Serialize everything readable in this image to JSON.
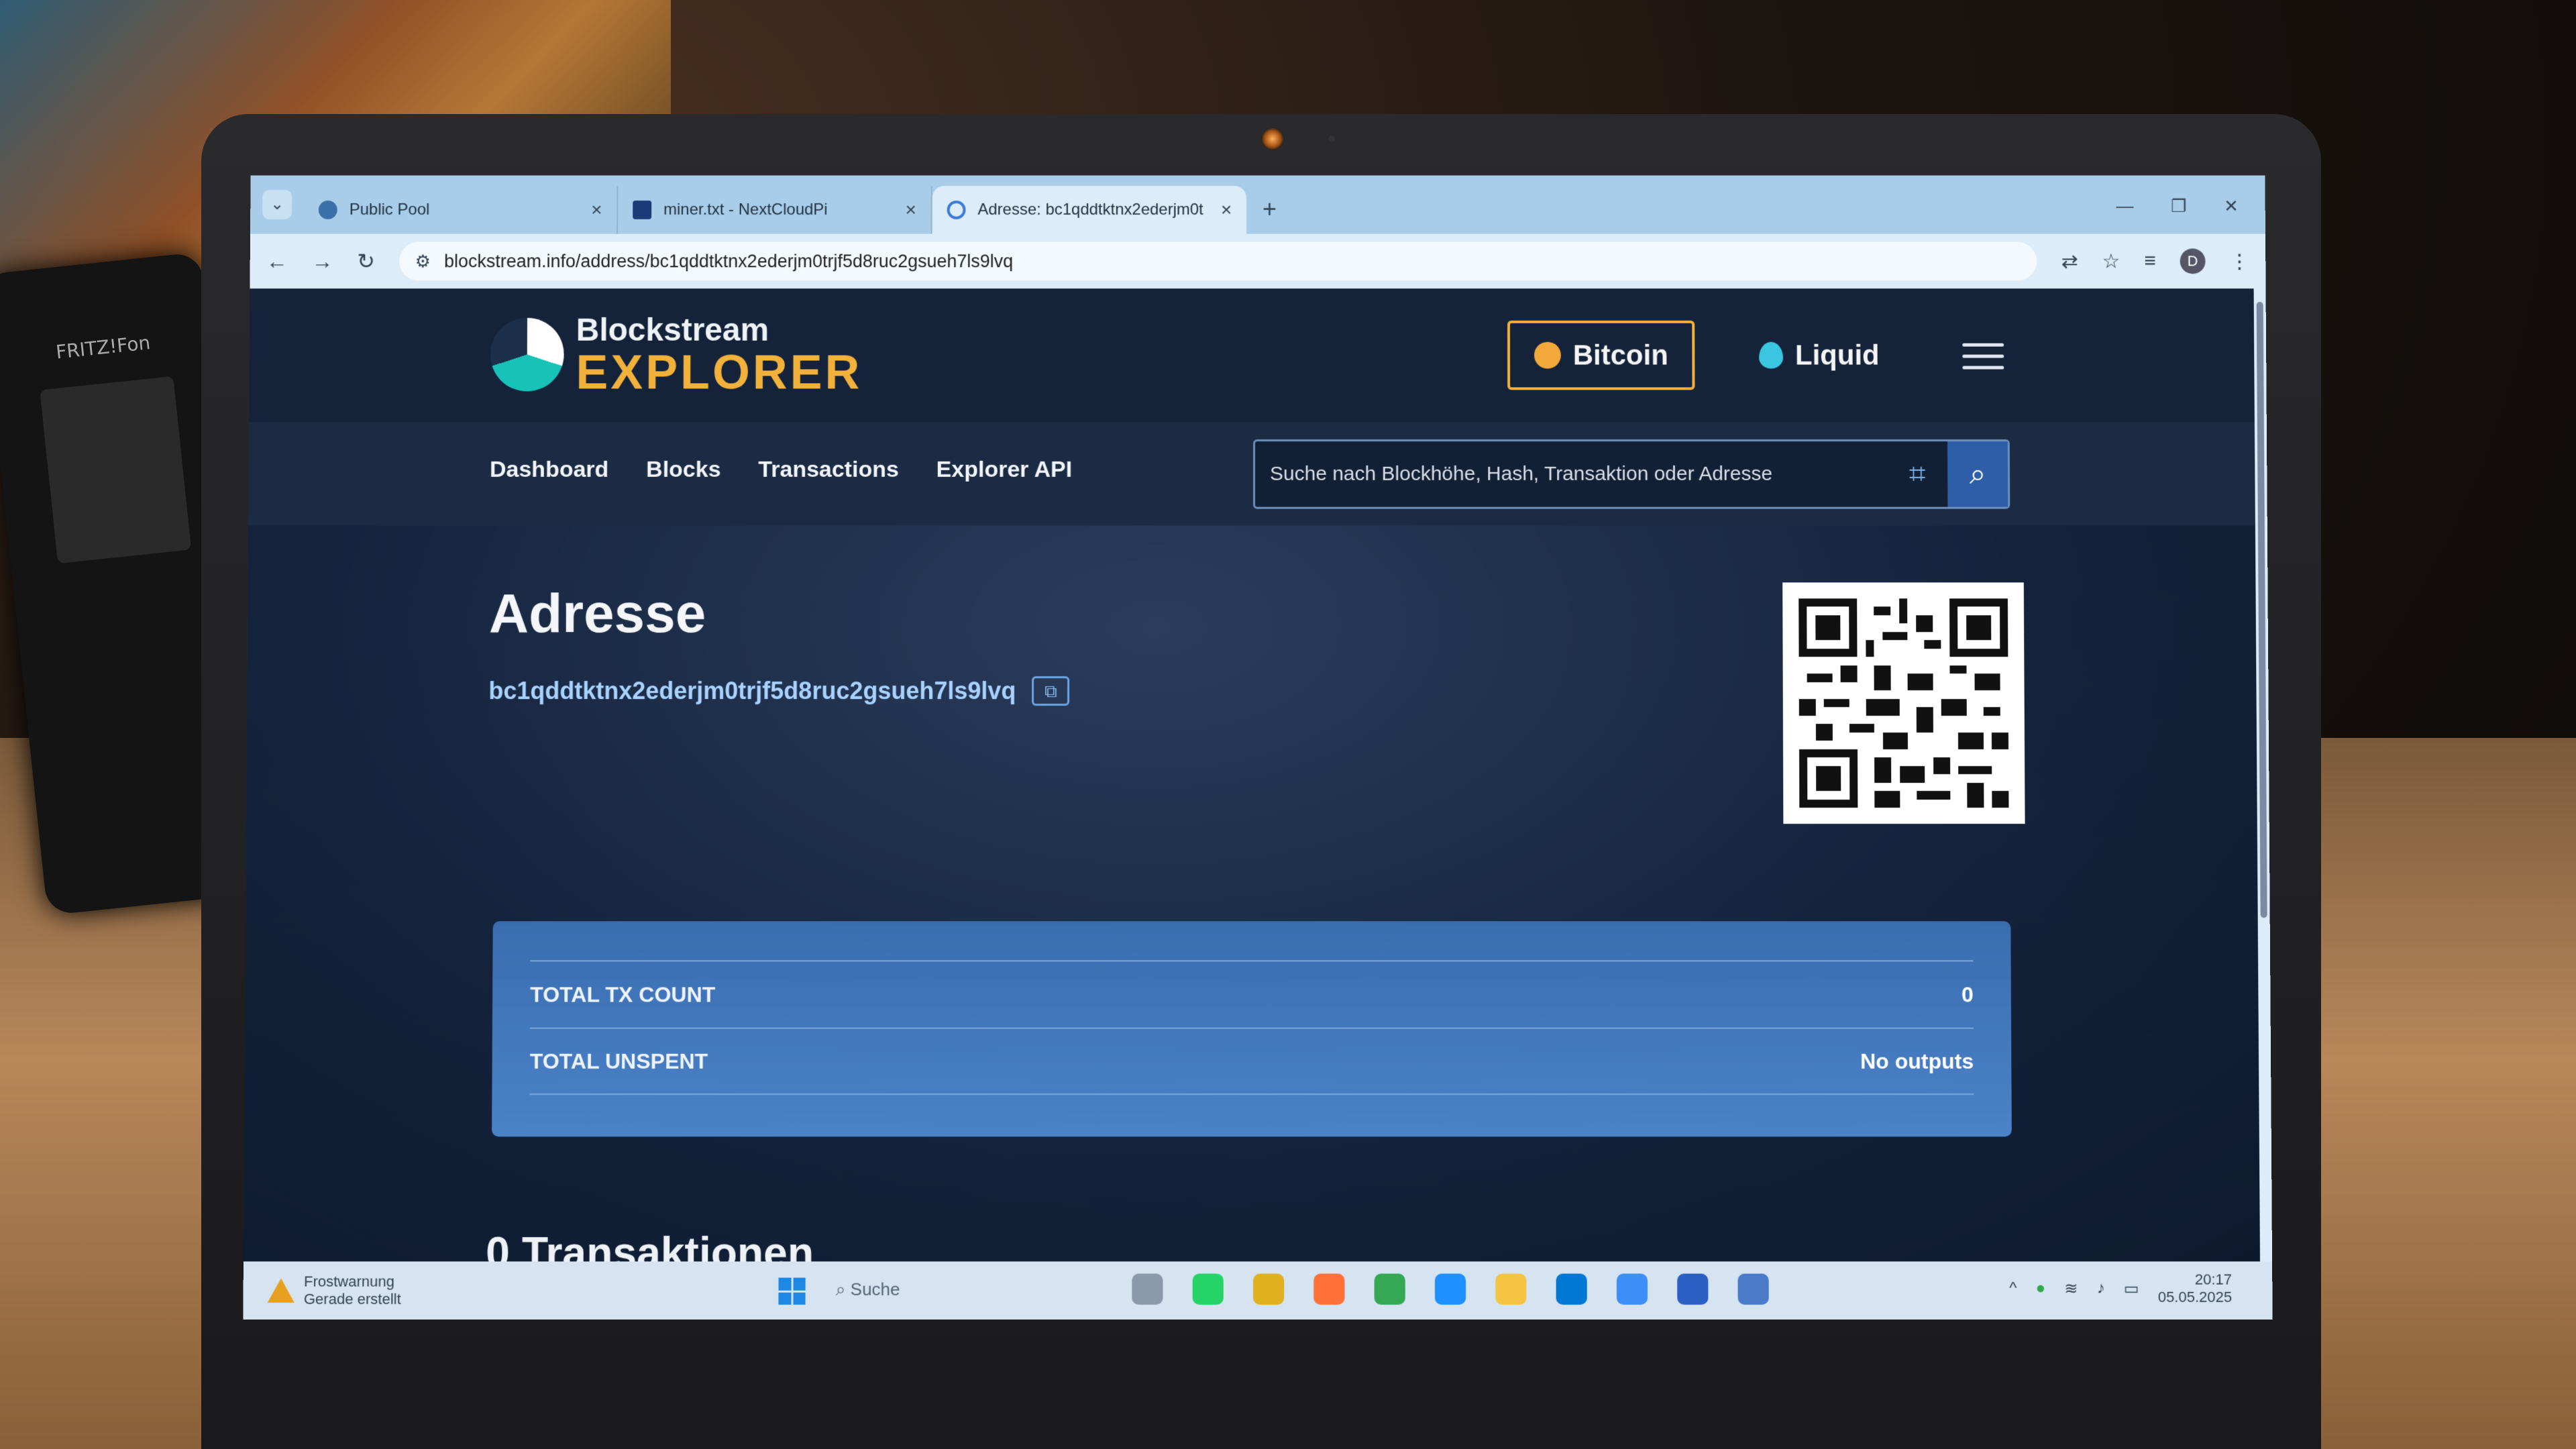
{
  "browser": {
    "tabs": [
      {
        "title": "Public Pool"
      },
      {
        "title": "miner.txt - NextCloudPi"
      },
      {
        "title": "Adresse: bc1qddtktnx2ederjm0t"
      }
    ],
    "url": "blockstream.info/address/bc1qddtktnx2ederjm0trjf5d8ruc2gsueh7ls9lvq",
    "profile_initial": "D"
  },
  "site": {
    "logo_line1": "Blockstream",
    "logo_line2": "EXPLORER",
    "network_buttons": {
      "bitcoin": "Bitcoin",
      "liquid": "Liquid"
    },
    "nav": {
      "dashboard": "Dashboard",
      "blocks": "Blocks",
      "transactions": "Transactions",
      "explorer_api": "Explorer API"
    },
    "search_placeholder": "Suche nach Blockhöhe, Hash, Transaktion oder Adresse"
  },
  "address_page": {
    "title": "Adresse",
    "address": "bc1qddtktnx2ederjm0trjf5d8ruc2gsueh7ls9lvq",
    "stats": [
      {
        "label": "TOTAL TX COUNT",
        "value": "0"
      },
      {
        "label": "TOTAL UNSPENT",
        "value": "No outputs"
      }
    ],
    "transactions_heading": "0 Transaktionen"
  },
  "taskbar": {
    "weather_line1": "Frostwarnung",
    "weather_line2": "Gerade erstellt",
    "search_label": "Suche",
    "time": "20:17",
    "date": "05.05.2025"
  },
  "colors": {
    "accent_gold": "#f2b13a",
    "stats_panel": "#3f74bb",
    "link_blue": "#a8d2ff"
  }
}
